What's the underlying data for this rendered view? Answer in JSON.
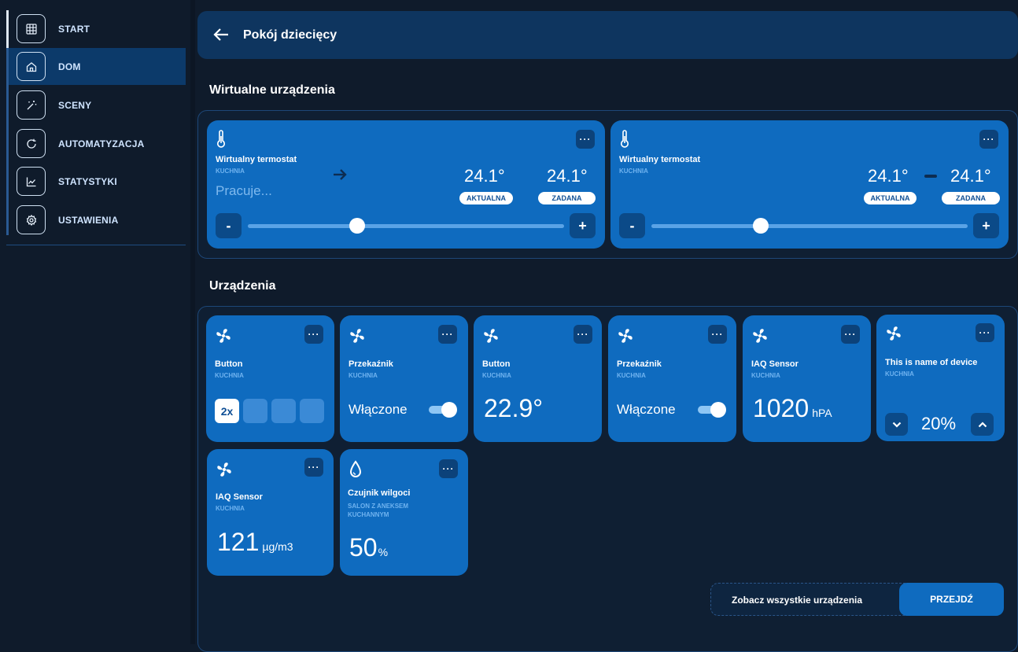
{
  "sidebar": {
    "items": [
      {
        "label": "START",
        "icon": "grid-icon"
      },
      {
        "label": "DOM",
        "icon": "home-icon"
      },
      {
        "label": "SCENY",
        "icon": "magic-wand-icon"
      },
      {
        "label": "AUTOMATYZACJA",
        "icon": "refresh-icon"
      },
      {
        "label": "STATYSTYKI",
        "icon": "chart-icon"
      },
      {
        "label": "USTAWIENIA",
        "icon": "gear-icon"
      }
    ],
    "active": "DOM"
  },
  "header": {
    "title": "Pokój dziecięcy"
  },
  "virtual": {
    "title": "Wirtualne urządzenia",
    "cards": [
      {
        "name": "Wirtualny termostat",
        "room": "KUCHNIA",
        "status": "Pracuje...",
        "current": "24.1°",
        "target": "24.1°",
        "current_label": "AKTUALNA",
        "target_label": "ZADANA",
        "minus": "-",
        "plus": "+",
        "slider": 0.35
      },
      {
        "name": "Wirtualny termostat",
        "room": "KUCHNIA",
        "current": "24.1°",
        "target": "24.1°",
        "current_label": "AKTUALNA",
        "target_label": "ZADANA",
        "minus": "-",
        "plus": "+",
        "slider": 0.35
      }
    ]
  },
  "devices": {
    "title": "Urządzenia",
    "cards": [
      {
        "name": "Button",
        "room": "KUCHNIA",
        "multiplier": "2x"
      },
      {
        "name": "Przekaźnik",
        "room": "KUCHNIA",
        "state": "Włączone"
      },
      {
        "name": "Button",
        "room": "KUCHNIA",
        "value": "22.9°"
      },
      {
        "name": "Przekaźnik",
        "room": "KUCHNIA",
        "state": "Włączone"
      },
      {
        "name": "IAQ Sensor",
        "room": "KUCHNIA",
        "value": "1020",
        "unit": "hPA"
      },
      {
        "name": "This is name of device",
        "room": "KUCHNIA",
        "value": "20%"
      },
      {
        "name": "IAQ Sensor",
        "room": "KUCHNIA",
        "value": "121",
        "unit": "µg/m3"
      },
      {
        "name": "Czujnik wilgoci",
        "room": "SALON Z ANEKSEM KUCHANNYM",
        "value": "50",
        "unit": "%"
      }
    ],
    "menu_label": "···"
  },
  "footer": {
    "text": "Zobacz wszystkie urządzenia",
    "button": "PRZEJDŹ"
  },
  "colors": {
    "accent": "#0f6bbf",
    "background": "#0f1b2b",
    "active_nav": "#0c3a6a"
  }
}
